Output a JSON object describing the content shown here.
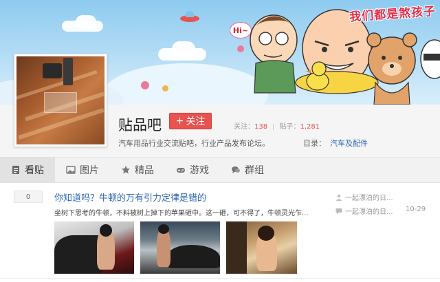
{
  "banner": {
    "slogan": "我们都是煞孩子",
    "hi_text": "Hi~"
  },
  "forum": {
    "name": "贴品吧",
    "follow_label": "关注",
    "follow_icon": "+",
    "stats": {
      "follow_label": "关注：",
      "follow_count": "138",
      "posts_label": "贴子：",
      "posts_count": "1,281"
    },
    "slogan": "汽车用品行业交流贴吧，行业产品发布论坛。",
    "catalog_label": "目录：",
    "catalog_link": "汽车及配件"
  },
  "tabs": [
    {
      "label": "看贴",
      "icon": "document-icon"
    },
    {
      "label": "图片",
      "icon": "image-icon"
    },
    {
      "label": "精品",
      "icon": "star-icon"
    },
    {
      "label": "游戏",
      "icon": "gamepad-icon"
    },
    {
      "label": "群组",
      "icon": "chat-icon"
    }
  ],
  "thread": {
    "reply_count": "0",
    "title": "你知道吗？牛顿的万有引力定律是错的",
    "excerpt": "坐树下思考的牛顿，不料被树上掉下的苹果砸中。这一砸，可不得了，牛顿灵光乍...",
    "author": "一起漂泊的日...",
    "last_replier": "一起漂泊的日...",
    "last_time": "10-29"
  },
  "colors": {
    "accent_red": "#e8524f",
    "link_blue": "#2d64b3"
  }
}
